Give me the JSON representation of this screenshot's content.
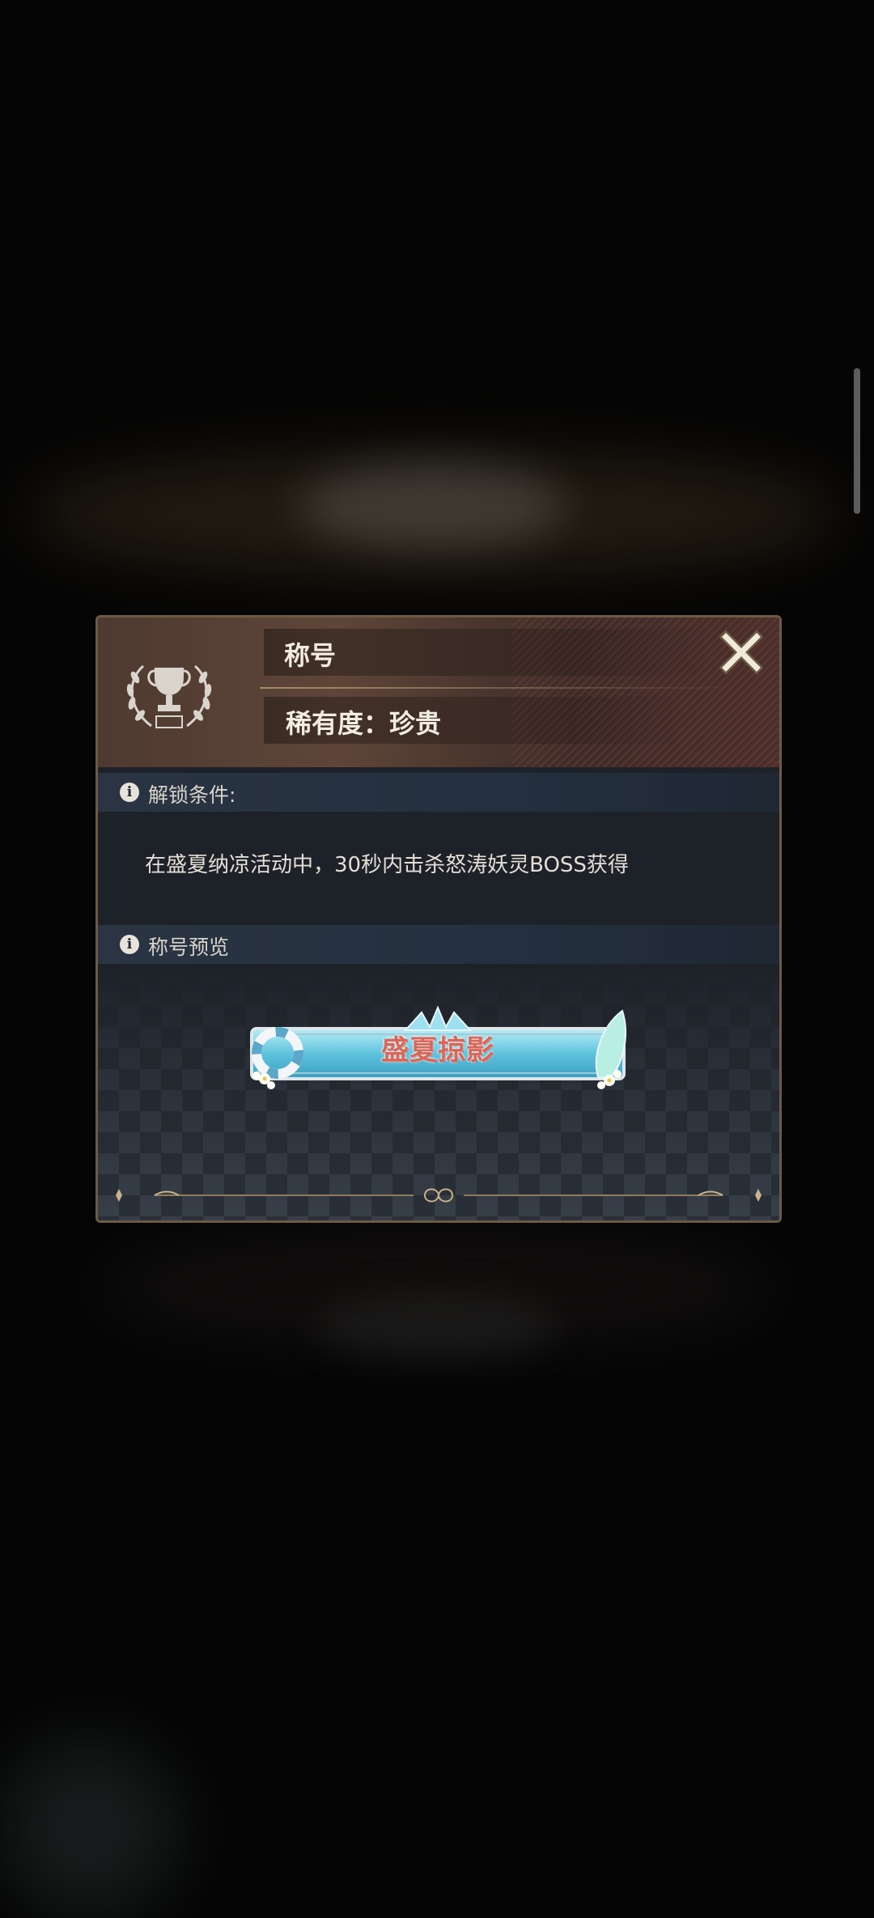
{
  "dialog": {
    "title": "称号",
    "rarity": "稀有度：珍贵",
    "unlock_section_label": "解锁条件:",
    "unlock_condition": "在盛夏纳凉活动中，30秒内击杀怒涛妖灵BOSS获得",
    "preview_section_label": "称号预览",
    "badge_text": "盛夏掠影",
    "close_icon": "close-x-icon",
    "trophy_icon": "trophy-laurel-icon"
  },
  "colors": {
    "header": "#4e3a31",
    "frame": "#6b5a44",
    "panel": "#1d2128",
    "badge_water": "#7ed2e6",
    "badge_text": "#d8665a"
  }
}
